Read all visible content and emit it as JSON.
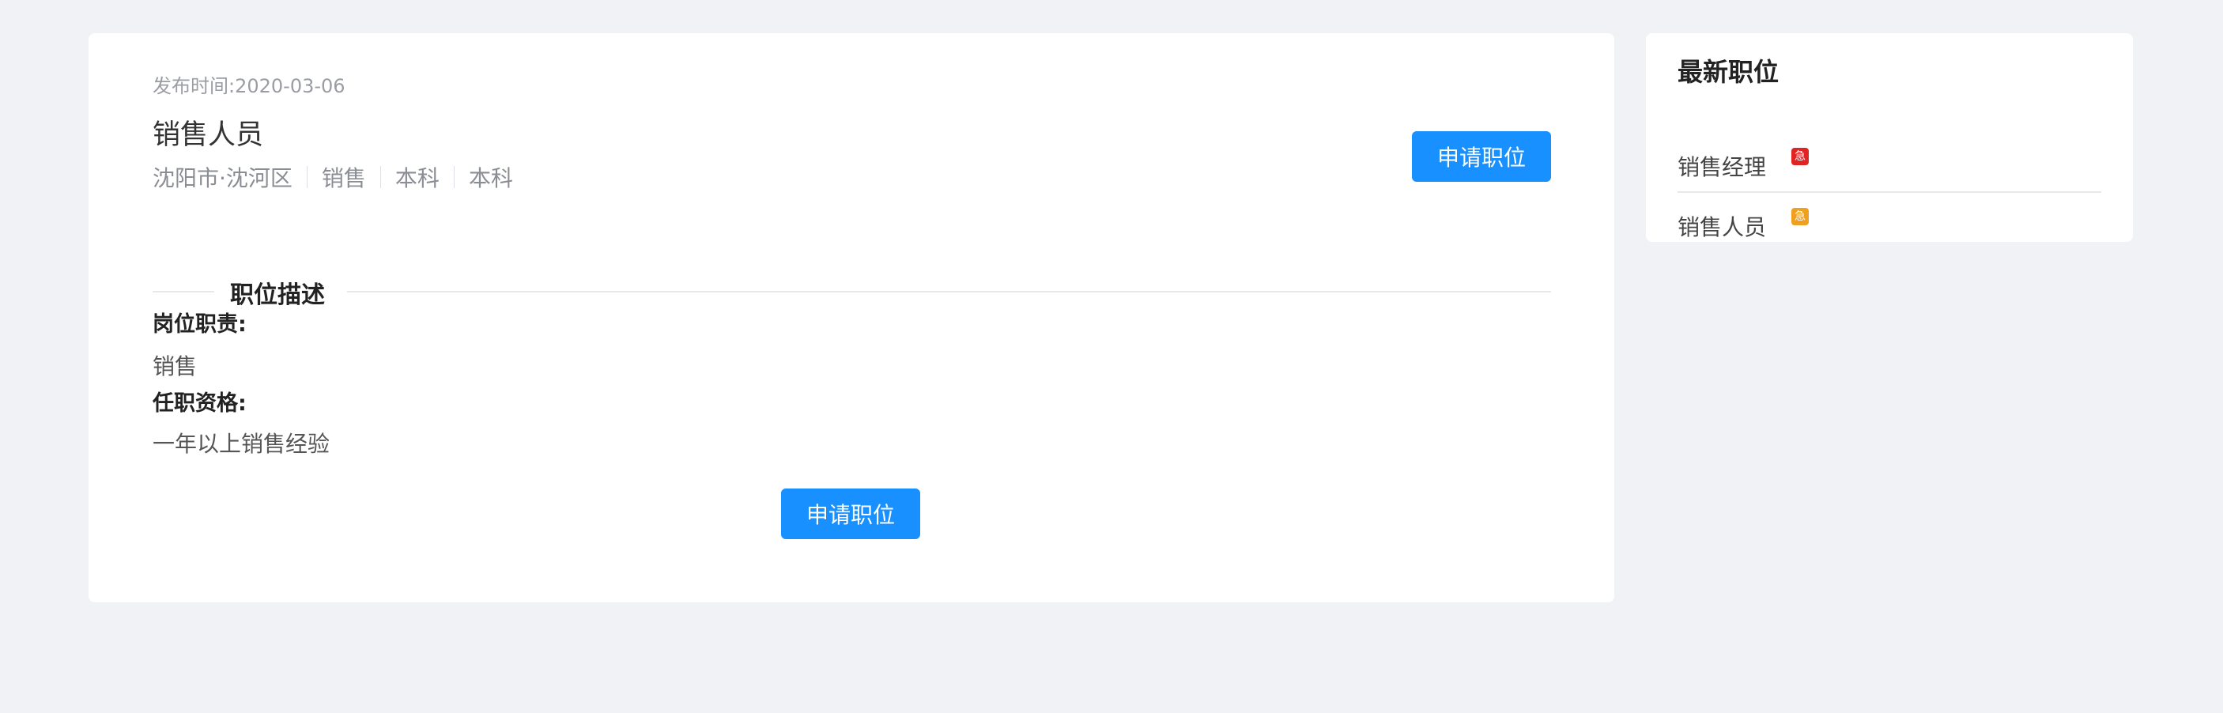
{
  "job": {
    "publish_time": "发布时间:2020-03-06",
    "title": "销售人员",
    "tags": [
      "沈阳市·沈河区",
      "销售",
      "本科",
      "本科"
    ],
    "apply_label": "申请职位"
  },
  "description": {
    "section_title": "职位描述",
    "duties_label": "岗位职责:",
    "duties_text": "销售",
    "qualifications_label": "任职资格:",
    "qualifications_text": "一年以上销售经验"
  },
  "sidebar": {
    "title": "最新职位",
    "items": [
      {
        "label": "销售经理",
        "badge": "急",
        "badge_color": "#e02424"
      },
      {
        "label": "销售人员",
        "badge": "急",
        "badge_color": "#f0a020"
      }
    ]
  },
  "colors": {
    "primary": "#1890ff",
    "background": "#f0f2f5"
  }
}
